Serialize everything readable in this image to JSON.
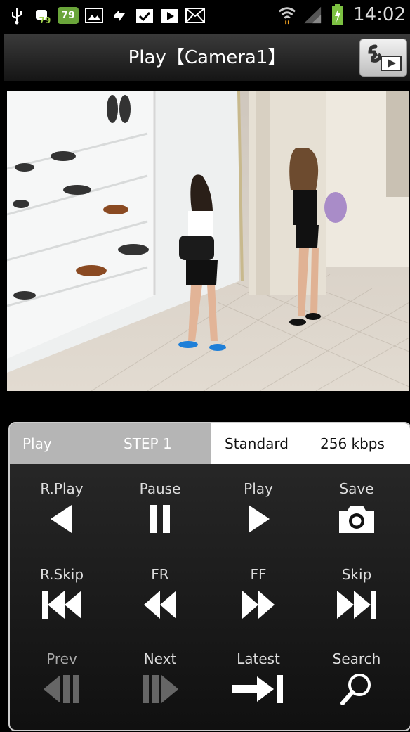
{
  "status_bar": {
    "left_badges": [
      "79",
      "79"
    ],
    "time": "14:02"
  },
  "title_bar": {
    "title": "Play【Camera1】"
  },
  "tabs": {
    "mode": "Play",
    "step": "STEP 1",
    "quality": "Standard",
    "bitrate": "256 kbps"
  },
  "controls": {
    "row1": [
      "R.Play",
      "Pause",
      "Play",
      "Save"
    ],
    "row2": [
      "R.Skip",
      "FR",
      "FF",
      "Skip"
    ],
    "row3": [
      "Prev",
      "Next",
      "Latest",
      "Search"
    ]
  },
  "colors": {
    "tab_left_bg": "#b5b5b5",
    "tab_right_bg": "#ffffff",
    "panel_border": "#cccccc"
  }
}
